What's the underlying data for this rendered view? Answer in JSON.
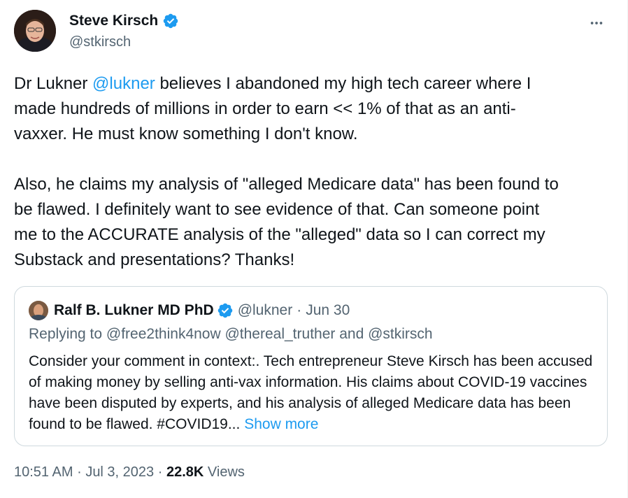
{
  "author": {
    "name": "Steve Kirsch",
    "handle": "@stkirsch"
  },
  "tweet": {
    "part1": "Dr Lukner ",
    "mention": "@lukner",
    "part2": " believes I abandoned my high tech career where I\nmade hundreds of millions in order to earn << 1% of that as an anti-\nvaxxer. He must know something I don't know.\n\nAlso, he claims my analysis of \"alleged Medicare data\" has been found to\nbe flawed. I definitely want to see evidence of that. Can someone point\nme to the ACCURATE analysis of the \"alleged\" data so I can correct my\nSubstack and presentations? Thanks!"
  },
  "quote": {
    "name": "Ralf B. Lukner MD PhD",
    "handle": "@lukner",
    "separator": "·",
    "date": "Jun 30",
    "replying": "Replying to @free2think4now @thereal_truther and @stkirsch",
    "text": "Consider your comment in context:. Tech entrepreneur Steve Kirsch has been accused of making money by selling anti-vax information. His claims about COVID-19 vaccines have been disputed by experts, and his analysis of alleged Medicare data has been found to be flawed. #COVID19...",
    "show_more": "Show more"
  },
  "footer": {
    "time": "10:51 AM",
    "date": "Jul 3, 2023",
    "views_count": "22.8K",
    "views_label": "Views",
    "separator": "·"
  },
  "colors": {
    "accent": "#1d9bf0",
    "text": "#0f1419",
    "muted": "#536471",
    "border": "#cfd9de"
  },
  "icons": {
    "verified": "verified-badge-icon",
    "more": "more-options-icon"
  }
}
